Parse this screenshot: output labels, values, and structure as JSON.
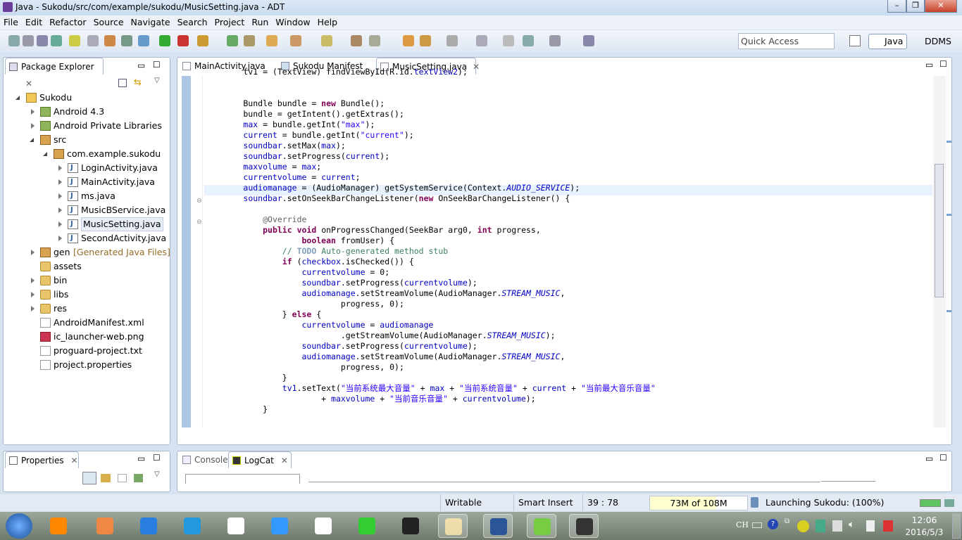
{
  "window": {
    "title": "Java - Sukodu/src/com/example/sukodu/MusicSetting.java - ADT",
    "controls": [
      "minimize",
      "maximize",
      "close"
    ]
  },
  "menu": [
    "File",
    "Edit",
    "Refactor",
    "Source",
    "Navigate",
    "Search",
    "Project",
    "Run",
    "Window",
    "Help"
  ],
  "toolbar": {
    "quick_access_placeholder": "Quick Access",
    "perspectives": [
      {
        "label": "Java",
        "active": true
      },
      {
        "label": "DDMS"
      }
    ]
  },
  "package_explorer": {
    "title": "Package Explorer",
    "tree": [
      {
        "level": 0,
        "label": "Sukodu",
        "icon": "proj",
        "state": "e"
      },
      {
        "level": 1,
        "label": "Android 4.3",
        "icon": "lib",
        "state": "c"
      },
      {
        "level": 1,
        "label": "Android Private Libraries",
        "icon": "lib",
        "state": "c"
      },
      {
        "level": 1,
        "label": "src",
        "icon": "pkg",
        "state": "e"
      },
      {
        "level": 2,
        "label": "com.example.sukodu",
        "icon": "pkg",
        "state": "e"
      },
      {
        "level": 3,
        "label": "LoginActivity.java",
        "icon": "java",
        "state": "c"
      },
      {
        "level": 3,
        "label": "MainActivity.java",
        "icon": "java",
        "state": "c"
      },
      {
        "level": 3,
        "label": "ms.java",
        "icon": "java",
        "state": "c"
      },
      {
        "level": 3,
        "label": "MusicBService.java",
        "icon": "java",
        "state": "c"
      },
      {
        "level": 3,
        "label": "MusicSetting.java",
        "icon": "java",
        "state": "c",
        "selected": true
      },
      {
        "level": 3,
        "label": "SecondActivity.java",
        "icon": "java",
        "state": "c"
      },
      {
        "level": 1,
        "label": "gen",
        "decoration": "[Generated Java Files]",
        "icon": "pkg",
        "state": "c"
      },
      {
        "level": 1,
        "label": "assets",
        "icon": "folder",
        "state": ""
      },
      {
        "level": 1,
        "label": "bin",
        "icon": "folder",
        "state": "c"
      },
      {
        "level": 1,
        "label": "libs",
        "icon": "folder",
        "state": "c"
      },
      {
        "level": 1,
        "label": "res",
        "icon": "folder",
        "state": "c"
      },
      {
        "level": 1,
        "label": "AndroidManifest.xml",
        "icon": "file",
        "state": ""
      },
      {
        "level": 1,
        "label": "ic_launcher-web.png",
        "icon": "img",
        "state": ""
      },
      {
        "level": 1,
        "label": "proguard-project.txt",
        "icon": "file",
        "state": ""
      },
      {
        "level": 1,
        "label": "project.properties",
        "icon": "file",
        "state": ""
      }
    ]
  },
  "editor": {
    "tabs": [
      {
        "label": "MainActivity.java"
      },
      {
        "label": "Sukodu Manifest"
      },
      {
        "label": "MusicSetting.java",
        "active": true
      }
    ],
    "lines": [
      [
        [
          "",
          "        tv1 = (TextView) findViewById(R.id."
        ],
        [
          "fd",
          "textView2"
        ],
        [
          "",
          ");"
        ]
      ],
      [],
      [],
      [
        [
          "",
          "        Bundle bundle = "
        ],
        [
          "kw",
          "new"
        ],
        [
          "",
          " Bundle();"
        ]
      ],
      [
        [
          "",
          "        bundle = getIntent().getExtras();"
        ]
      ],
      [
        [
          "",
          "        "
        ],
        [
          "fd",
          "max"
        ],
        [
          "",
          " = bundle.getInt("
        ],
        [
          "st",
          "\"max\""
        ],
        [
          "",
          ");"
        ]
      ],
      [
        [
          "",
          "        "
        ],
        [
          "fd",
          "current"
        ],
        [
          "",
          " = bundle.getInt("
        ],
        [
          "st",
          "\"current\""
        ],
        [
          "",
          ");"
        ]
      ],
      [
        [
          "",
          "        "
        ],
        [
          "fd",
          "soundbar"
        ],
        [
          "",
          ".setMax("
        ],
        [
          "fd",
          "max"
        ],
        [
          "",
          ");"
        ]
      ],
      [
        [
          "",
          "        "
        ],
        [
          "fd",
          "soundbar"
        ],
        [
          "",
          ".setProgress("
        ],
        [
          "fd",
          "current"
        ],
        [
          "",
          ");"
        ]
      ],
      [
        [
          "",
          "        "
        ],
        [
          "fd",
          "maxvolume"
        ],
        [
          "",
          " = "
        ],
        [
          "fd",
          "max"
        ],
        [
          "",
          ";"
        ]
      ],
      [
        [
          "",
          "        "
        ],
        [
          "fd",
          "currentvolume"
        ],
        [
          "",
          " = "
        ],
        [
          "fd",
          "current"
        ],
        [
          "",
          ";"
        ]
      ],
      [
        [
          "",
          "        "
        ],
        [
          "fd",
          "audiomanage"
        ],
        [
          "",
          " = (AudioManager) getSystemService(Context."
        ],
        [
          "sf",
          "AUDIO_SERVICE"
        ],
        [
          "",
          ");"
        ]
      ],
      [
        [
          "",
          "        "
        ],
        [
          "fd",
          "soundbar"
        ],
        [
          "",
          ".setOnSeekBarChangeListener("
        ],
        [
          "kw",
          "new"
        ],
        [
          "",
          " OnSeekBarChangeListener() {"
        ]
      ],
      [],
      [
        [
          "",
          "            "
        ],
        [
          "an",
          "@Override"
        ]
      ],
      [
        [
          "",
          "            "
        ],
        [
          "kw",
          "public"
        ],
        [
          "",
          " "
        ],
        [
          "kw",
          "void"
        ],
        [
          "",
          " onProgressChanged(SeekBar arg0, "
        ],
        [
          "kw",
          "int"
        ],
        [
          "",
          " progress,"
        ]
      ],
      [
        [
          "",
          "                    "
        ],
        [
          "kw",
          "boolean"
        ],
        [
          "",
          " fromUser) {"
        ]
      ],
      [
        [
          "",
          "                "
        ],
        [
          "cm",
          "// "
        ],
        [
          "tk",
          "TODO"
        ],
        [
          "cm",
          " Auto-generated method stub"
        ]
      ],
      [
        [
          "",
          "                "
        ],
        [
          "kw",
          "if"
        ],
        [
          "",
          " ("
        ],
        [
          "fd",
          "checkbox"
        ],
        [
          "",
          ".isChecked()) {"
        ]
      ],
      [
        [
          "",
          "                    "
        ],
        [
          "fd",
          "currentvolume"
        ],
        [
          "",
          " = 0;"
        ]
      ],
      [
        [
          "",
          "                    "
        ],
        [
          "fd",
          "soundbar"
        ],
        [
          "",
          ".setProgress("
        ],
        [
          "fd",
          "currentvolume"
        ],
        [
          "",
          ");"
        ]
      ],
      [
        [
          "",
          "                    "
        ],
        [
          "fd",
          "audiomanage"
        ],
        [
          "",
          ".setStreamVolume(AudioManager."
        ],
        [
          "sf",
          "STREAM_MUSIC"
        ],
        [
          "",
          ","
        ]
      ],
      [
        [
          "",
          "                            progress, 0);"
        ]
      ],
      [
        [
          "",
          "                } "
        ],
        [
          "kw",
          "else"
        ],
        [
          "",
          " {"
        ]
      ],
      [
        [
          "",
          "                    "
        ],
        [
          "fd",
          "currentvolume"
        ],
        [
          "",
          " = "
        ],
        [
          "fd",
          "audiomanage"
        ]
      ],
      [
        [
          "",
          "                            .getStreamVolume(AudioManager."
        ],
        [
          "sf",
          "STREAM_MUSIC"
        ],
        [
          "",
          ");"
        ]
      ],
      [
        [
          "",
          "                    "
        ],
        [
          "fd",
          "soundbar"
        ],
        [
          "",
          ".setProgress("
        ],
        [
          "fd",
          "currentvolume"
        ],
        [
          "",
          ");"
        ]
      ],
      [
        [
          "",
          "                    "
        ],
        [
          "fd",
          "audiomanage"
        ],
        [
          "",
          ".setStreamVolume(AudioManager."
        ],
        [
          "sf",
          "STREAM_MUSIC"
        ],
        [
          "",
          ","
        ]
      ],
      [
        [
          "",
          "                            progress, 0);"
        ]
      ],
      [
        [
          "",
          "                }"
        ]
      ],
      [
        [
          "",
          "                "
        ],
        [
          "fd",
          "tv1"
        ],
        [
          "",
          ".setText("
        ],
        [
          "st",
          "\"当前系统最大音量\""
        ],
        [
          "",
          " + "
        ],
        [
          "fd",
          "max"
        ],
        [
          "",
          " + "
        ],
        [
          "st",
          "\"当前系统音量\""
        ],
        [
          "",
          " + "
        ],
        [
          "fd",
          "current"
        ],
        [
          "",
          " + "
        ],
        [
          "st",
          "\"当前最大音乐音量\""
        ]
      ],
      [
        [
          "",
          "                        + "
        ],
        [
          "fd",
          "maxvolume"
        ],
        [
          "",
          " + "
        ],
        [
          "st",
          "\"当前音乐音量\""
        ],
        [
          "",
          " + "
        ],
        [
          "fd",
          "currentvolume"
        ],
        [
          "",
          ");"
        ]
      ],
      [
        [
          "",
          "            }"
        ]
      ]
    ],
    "highlight_line": 11
  },
  "properties": {
    "title": "Properties"
  },
  "bottom": {
    "tabs": [
      {
        "label": "Console"
      },
      {
        "label": "LogCat",
        "active": true
      }
    ]
  },
  "status": {
    "writable": "Writable",
    "insert_mode": "Smart Insert",
    "position": "39 : 78",
    "memory": "73M of 108M",
    "memory_used_fraction": 0.68,
    "launch": "Launching Sukodu: (100%)"
  },
  "taskbar": {
    "lang": "CH",
    "time": "12:06",
    "date": "2016/5/3"
  }
}
